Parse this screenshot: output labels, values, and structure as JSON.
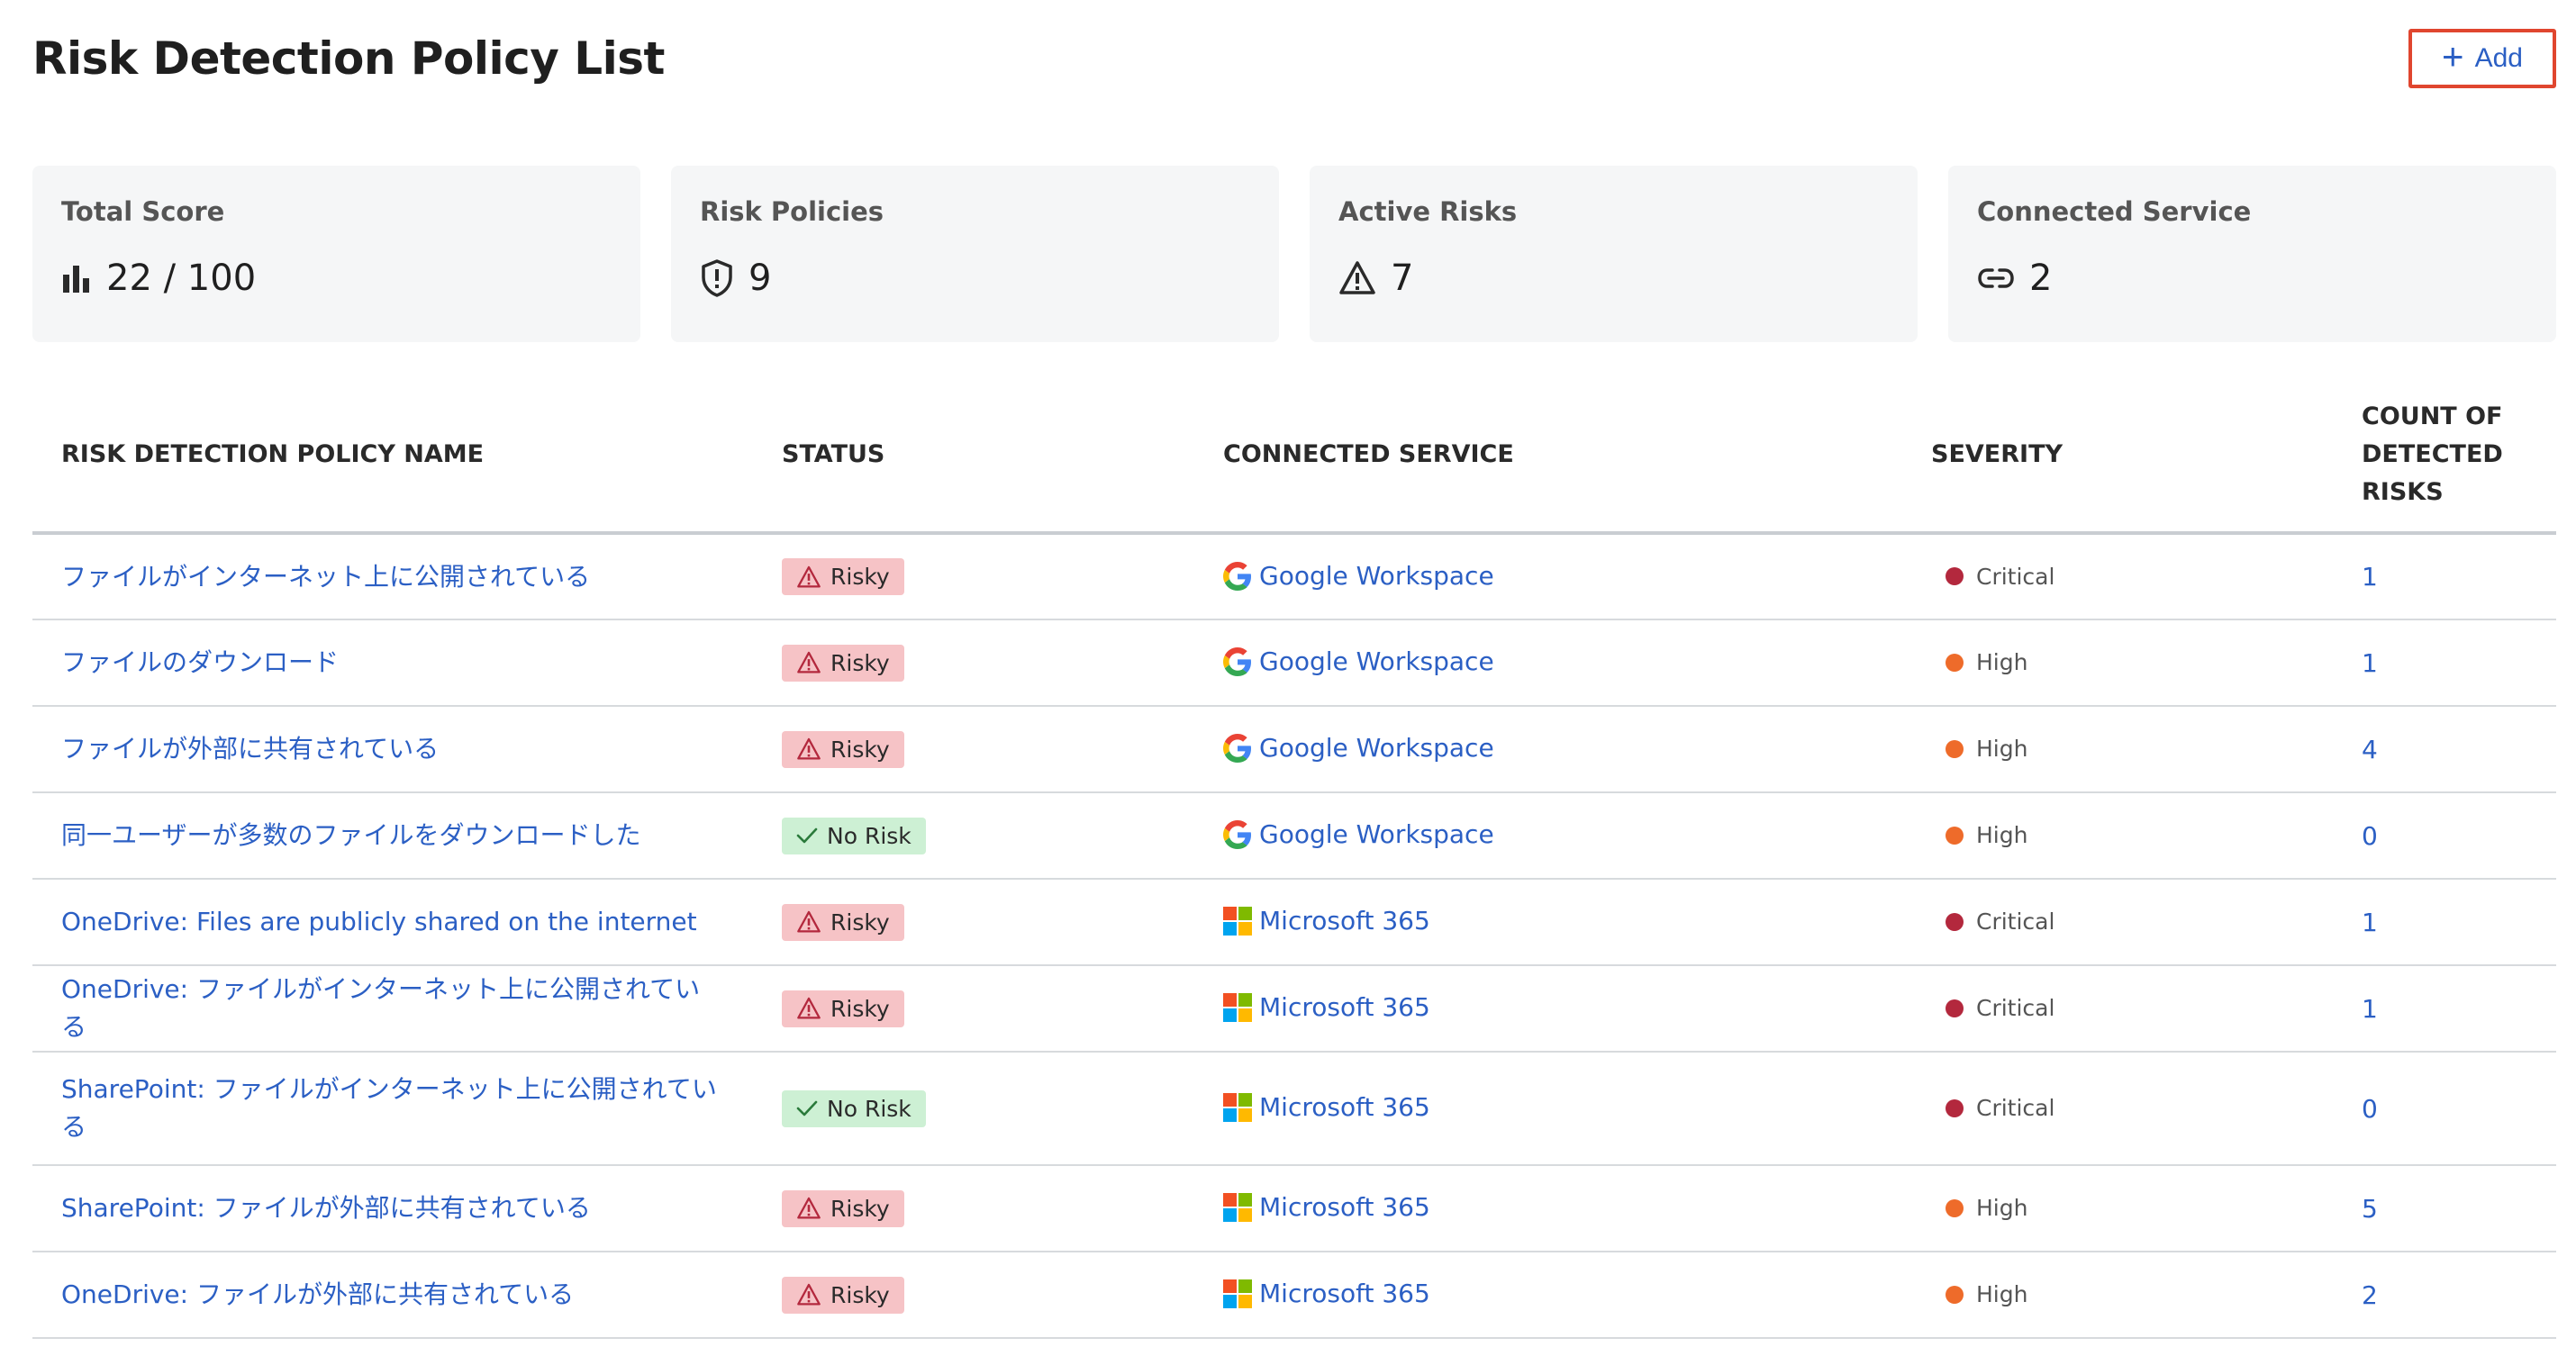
{
  "header": {
    "title": "Risk Detection Policy List",
    "add_label": "Add"
  },
  "summary": [
    {
      "label": "Total Score",
      "value": "22 / 100",
      "icon": "bar-chart-icon"
    },
    {
      "label": "Risk Policies",
      "value": "9",
      "icon": "shield-alert-icon"
    },
    {
      "label": "Active Risks",
      "value": "7",
      "icon": "warning-triangle-icon"
    },
    {
      "label": "Connected Service",
      "value": "2",
      "icon": "link-icon"
    }
  ],
  "table": {
    "headers": {
      "name": "RISK DETECTION POLICY NAME",
      "status": "STATUS",
      "service": "CONNECTED SERVICE",
      "severity": "SEVERITY",
      "count": "COUNT OF DETECTED RISKS"
    },
    "rows": [
      {
        "name": "ファイルがインターネット上に公開されている",
        "status": "Risky",
        "service": "Google Workspace",
        "severity": "Critical",
        "count": "1"
      },
      {
        "name": "ファイルのダウンロード",
        "status": "Risky",
        "service": "Google Workspace",
        "severity": "High",
        "count": "1"
      },
      {
        "name": "ファイルが外部に共有されている",
        "status": "Risky",
        "service": "Google Workspace",
        "severity": "High",
        "count": "4"
      },
      {
        "name": "同一ユーザーが多数のファイルをダウンロードした",
        "status": "No Risk",
        "service": "Google Workspace",
        "severity": "High",
        "count": "0"
      },
      {
        "name": "OneDrive: Files are publicly shared on the internet",
        "status": "Risky",
        "service": "Microsoft 365",
        "severity": "Critical",
        "count": "1"
      },
      {
        "name": "OneDrive: ファイルがインターネット上に公開されている",
        "status": "Risky",
        "service": "Microsoft 365",
        "severity": "Critical",
        "count": "1"
      },
      {
        "name": "SharePoint: ファイルがインターネット上に公開されている",
        "status": "No Risk",
        "service": "Microsoft 365",
        "severity": "Critical",
        "count": "0"
      },
      {
        "name": "SharePoint: ファイルが外部に共有されている",
        "status": "Risky",
        "service": "Microsoft 365",
        "severity": "High",
        "count": "5"
      },
      {
        "name": "OneDrive: ファイルが外部に共有されている",
        "status": "Risky",
        "service": "Microsoft 365",
        "severity": "High",
        "count": "2"
      }
    ]
  },
  "colors": {
    "link": "#2b5fc4",
    "critical": "#b3283d",
    "high": "#ee6b2a",
    "risky_bg": "#f6c3c6",
    "norisk_bg": "#cdf0d4",
    "add_border": "#e0462f"
  }
}
